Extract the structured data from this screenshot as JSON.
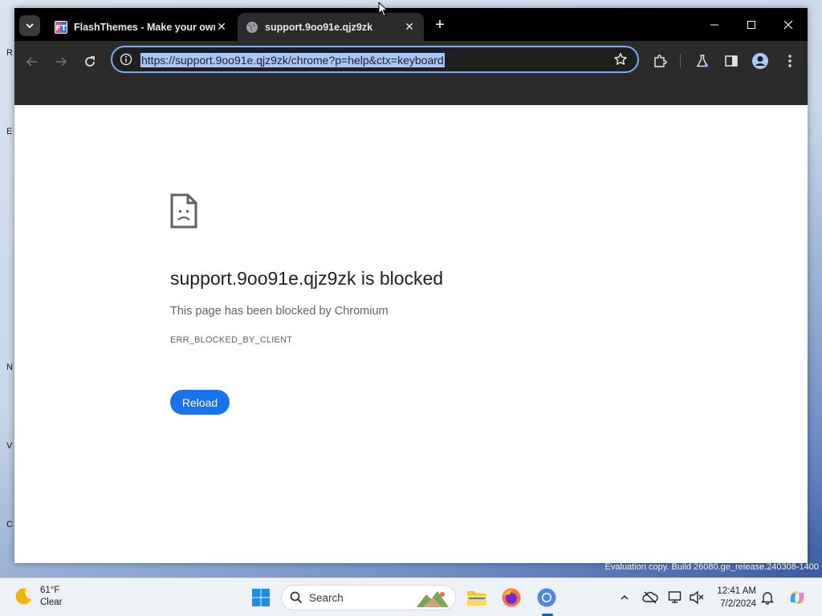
{
  "browser": {
    "tabs": [
      {
        "title": "FlashThemes - Make your own",
        "active": false
      },
      {
        "title": "support.9oo91e.qjz9zk",
        "active": true
      }
    ],
    "address_bar": {
      "url": "https://support.9oo91e.qjz9zk/chrome?p=help&ctx=keyboard"
    },
    "accent_color": "#7cacf8"
  },
  "error_page": {
    "title": "support.9oo91e.qjz9zk is blocked",
    "message": "This page has been blocked by Chromium",
    "code": "ERR_BLOCKED_BY_CLIENT",
    "reload_label": "Reload",
    "button_color": "#1a73e8"
  },
  "desktop": {
    "watermark": "Evaluation copy. Build 26080.ge_release.240308-1400"
  },
  "taskbar": {
    "weather": {
      "temp": "61°F",
      "condition": "Clear"
    },
    "search_label": "Search",
    "clock": {
      "time": "12:41 AM",
      "date": "7/2/2024"
    }
  }
}
